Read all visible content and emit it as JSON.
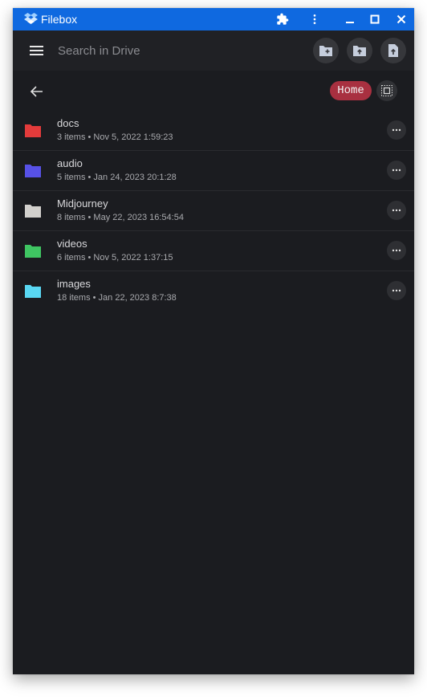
{
  "window": {
    "title": "Filebox",
    "logo_icon": "dropbox-box-icon",
    "controls": [
      "extension-icon",
      "more-vert-icon",
      "minimize-icon",
      "maximize-icon",
      "close-icon"
    ]
  },
  "topbar": {
    "menu_icon": "hamburger-menu-icon",
    "search_placeholder": "Search in Drive",
    "actions": [
      "new-folder-icon",
      "upload-folder-icon",
      "upload-file-icon"
    ]
  },
  "nav": {
    "back_icon": "arrow-left-icon",
    "breadcrumb_label": "Home",
    "breadcrumb_color": "#a83040",
    "select_icon": "select-all-icon"
  },
  "files": [
    {
      "name": "docs",
      "meta": "3 items • Nov 5, 2022 1:59:23",
      "color": "#e33b3b"
    },
    {
      "name": "audio",
      "meta": "5 items • Jan 24, 2023 20:1:28",
      "color": "#5751e6"
    },
    {
      "name": "Midjourney",
      "meta": "8 items • May 22, 2023 16:54:54",
      "color": "#d2d0cd"
    },
    {
      "name": "videos",
      "meta": "6 items • Nov 5, 2022 1:37:15",
      "color": "#3fc562"
    },
    {
      "name": "images",
      "meta": "18 items • Jan 22, 2023 8:7:38",
      "color": "#59d7f2"
    }
  ],
  "colors": {
    "titlebar": "#0f69e0",
    "background": "#1b1c20",
    "topbar": "#202125"
  }
}
